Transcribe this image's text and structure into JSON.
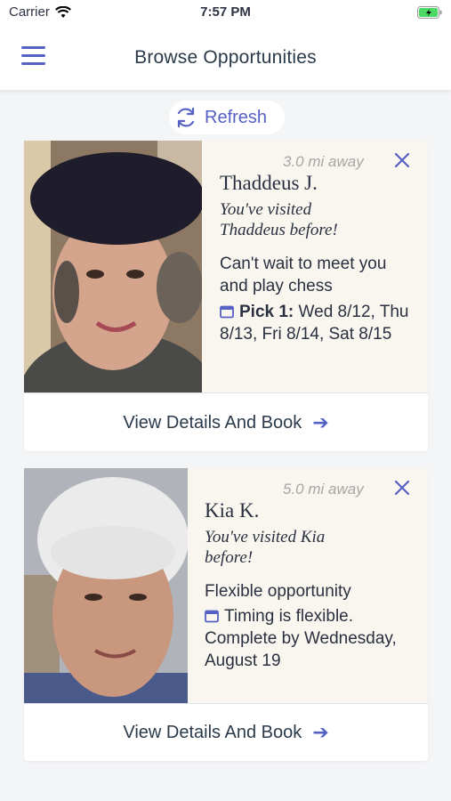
{
  "status_bar": {
    "carrier": "Carrier",
    "time": "7:57 PM"
  },
  "header": {
    "title": "Browse Opportunities",
    "menu_icon": "hamburger-menu-icon"
  },
  "refresh": {
    "label": "Refresh",
    "icon": "refresh-icon"
  },
  "colors": {
    "accent": "#5661c5",
    "card_bg": "#f8f6ee",
    "page_bg": "#f4f5f7"
  },
  "cards": [
    {
      "distance": "3.0 mi away",
      "name": "Thaddeus J.",
      "visited": "You've visited Thaddeus before!",
      "description": "Can't wait to meet you and play chess",
      "schedule_prefix": "Pick 1:",
      "schedule": "Wed 8/12, Thu 8/13, Fri 8/14, Sat 8/15",
      "button": "View Details And Book"
    },
    {
      "distance": "5.0 mi away",
      "name": "Kia K.",
      "visited": "You've visited Kia before!",
      "description": "Flexible opportunity",
      "schedule_prefix": "",
      "schedule": "Timing is flexible. Complete by Wednesday, August 19",
      "button": "View Details And Book"
    }
  ]
}
